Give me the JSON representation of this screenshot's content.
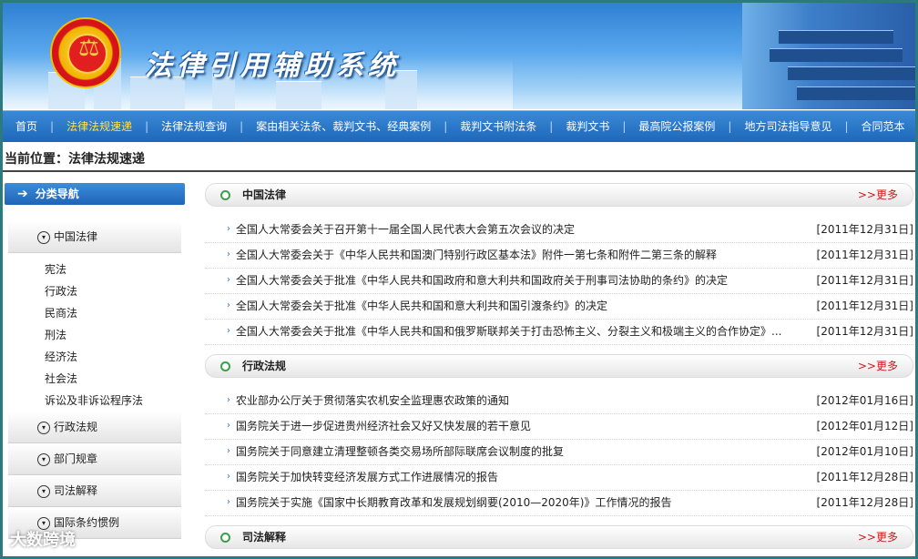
{
  "site": {
    "title": "法律引用辅助系统"
  },
  "nav": [
    {
      "label": "首页"
    },
    {
      "label": "法律法规速递"
    },
    {
      "label": "法律法规查询"
    },
    {
      "label": "案由相关法条、裁判文书、经典案例"
    },
    {
      "label": "裁判文书附法条"
    },
    {
      "label": "裁判文书"
    },
    {
      "label": "最高院公报案例"
    },
    {
      "label": "地方司法指导意见"
    },
    {
      "label": "合同范本"
    }
  ],
  "breadcrumb": {
    "text": "当前位置：法律法规速递"
  },
  "sidebar": {
    "header": "分类导航",
    "categories": [
      {
        "label": "中国法律"
      },
      {
        "label": "行政法规"
      },
      {
        "label": "部门规章"
      },
      {
        "label": "司法解释"
      },
      {
        "label": "国际条约惯例"
      }
    ],
    "subitems": [
      "宪法",
      "行政法",
      "民商法",
      "刑法",
      "经济法",
      "社会法",
      "诉讼及非诉讼程序法"
    ]
  },
  "sections": [
    {
      "title": "中国法律",
      "more": ">>更多",
      "items": [
        {
          "text": "全国人大常委会关于召开第十一届全国人民代表大会第五次会议的决定",
          "date": "[2011年12月31日]"
        },
        {
          "text": "全国人大常委会关于《中华人民共和国澳门特别行政区基本法》附件一第七条和附件二第三条的解释",
          "date": "[2011年12月31日]"
        },
        {
          "text": "全国人大常委会关于批准《中华人民共和国政府和意大利共和国政府关于刑事司法协助的条约》的决定",
          "date": "[2011年12月31日]"
        },
        {
          "text": "全国人大常委会关于批准《中华人民共和国和意大利共和国引渡条约》的决定",
          "date": "[2011年12月31日]"
        },
        {
          "text": "全国人大常委会关于批准《中华人民共和国和俄罗斯联邦关于打击恐怖主义、分裂主义和极端主义的合作协定》...",
          "date": "[2011年12月31日]"
        }
      ]
    },
    {
      "title": "行政法规",
      "more": ">>更多",
      "items": [
        {
          "text": "农业部办公厅关于贯彻落实农机安全监理惠农政策的通知",
          "date": "[2012年01月16日]"
        },
        {
          "text": "国务院关于进一步促进贵州经济社会又好又快发展的若干意见",
          "date": "[2012年01月12日]"
        },
        {
          "text": "国务院关于同意建立清理整顿各类交易场所部际联席会议制度的批复",
          "date": "[2012年01月10日]"
        },
        {
          "text": "国务院关于加快转变经济发展方式工作进展情况的报告",
          "date": "[2011年12月28日]"
        },
        {
          "text": "国务院关于实施《国家中长期教育改革和发展规划纲要(2010—2020年)》工作情况的报告",
          "date": "[2011年12月28日]"
        }
      ]
    },
    {
      "title": "司法解释",
      "more": ">>更多",
      "items": []
    }
  ],
  "watermark": "大数跨境"
}
